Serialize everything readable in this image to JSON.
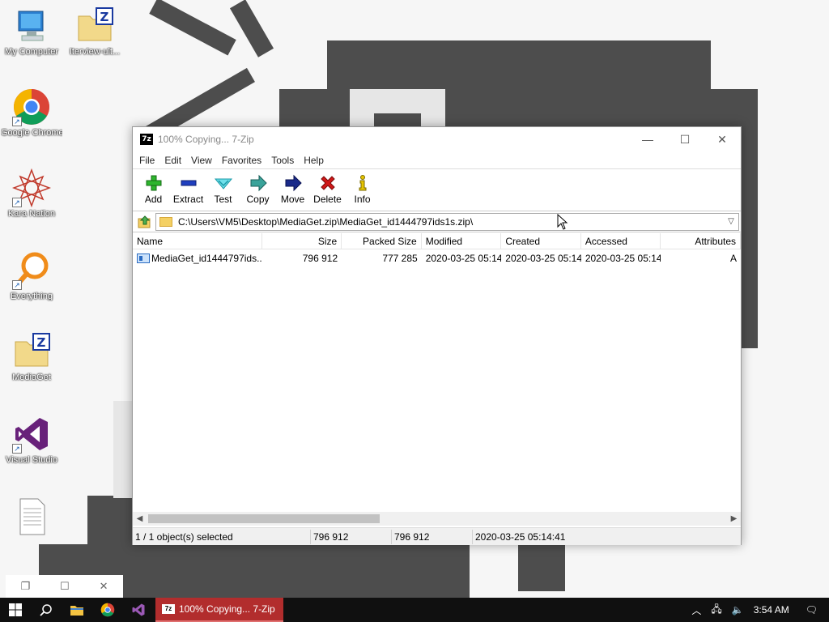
{
  "desktop": {
    "icons": [
      {
        "label": "My Computer",
        "icon": "computer-icon"
      },
      {
        "label": "Iterview-ult...",
        "icon": "zip-folder-icon"
      },
      {
        "label": "Google Chrome",
        "icon": "chrome-icon"
      },
      {
        "label": "Kara Nation",
        "icon": "mandala-icon"
      },
      {
        "label": "Everything",
        "icon": "search-magnifier-icon"
      },
      {
        "label": "MediaGet",
        "icon": "zip-folder-icon"
      },
      {
        "label": "Visual Studio",
        "icon": "visual-studio-icon"
      },
      {
        "label": "",
        "icon": "text-file-icon"
      }
    ]
  },
  "window": {
    "title": "100% Copying... 7-Zip",
    "app_icon": "7z",
    "controls": {
      "minimize": "—",
      "maximize": "☐",
      "close": "✕"
    },
    "menu": [
      "File",
      "Edit",
      "View",
      "Favorites",
      "Tools",
      "Help"
    ],
    "toolbar": [
      {
        "label": "Add",
        "icon": "plus-icon",
        "color": "#2db52d"
      },
      {
        "label": "Extract",
        "icon": "minus-icon",
        "color": "#1f3fbf"
      },
      {
        "label": "Test",
        "icon": "check-icon",
        "color": "#1fb5c5"
      },
      {
        "label": "Copy",
        "icon": "copy-arrow-icon",
        "color": "#1a8a8a"
      },
      {
        "label": "Move",
        "icon": "move-arrow-icon",
        "color": "#1a2a8a"
      },
      {
        "label": "Delete",
        "icon": "delete-x-icon",
        "color": "#d01818"
      },
      {
        "label": "Info",
        "icon": "info-icon",
        "color": "#d8b800"
      }
    ],
    "address": "C:\\Users\\VM5\\Desktop\\MediaGet.zip\\MediaGet_id1444797ids1s.zip\\",
    "columns": [
      "Name",
      "Size",
      "Packed Size",
      "Modified",
      "Created",
      "Accessed",
      "Attributes"
    ],
    "rows": [
      {
        "name": "MediaGet_id1444797ids...",
        "size": "796 912",
        "packed": "777 285",
        "modified": "2020-03-25 05:14",
        "created": "2020-03-25 05:14",
        "accessed": "2020-03-25 05:14",
        "attributes": "A"
      }
    ],
    "status": {
      "selected": "1 / 1 object(s) selected",
      "size": "796 912",
      "packed": "796 912",
      "date": "2020-03-25 05:14:41"
    }
  },
  "mini_window_controls": {
    "restore": "❐",
    "maximize": "☐",
    "close": "✕"
  },
  "taskbar": {
    "active_task": "100% Copying... 7-Zip",
    "time": "3:54 AM",
    "colors": {
      "active_task": "#b22d2d",
      "bar": "#101010"
    }
  }
}
